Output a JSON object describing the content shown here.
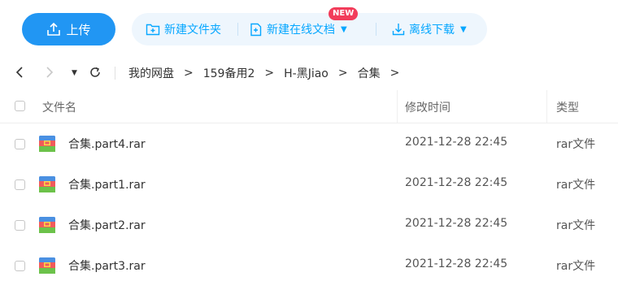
{
  "toolbar": {
    "upload_label": "上传",
    "new_folder_label": "新建文件夹",
    "new_online_doc_label": "新建在线文档",
    "new_badge": "NEW",
    "offline_download_label": "离线下载",
    "accent_color": "#2196f3"
  },
  "breadcrumb": {
    "items": [
      "我的网盘",
      "159备用2",
      "H-黑Jiao",
      "合集"
    ],
    "separator": ">"
  },
  "table": {
    "columns": [
      "文件名",
      "修改时间",
      "类型"
    ],
    "rows": [
      {
        "name": "合集.part4.rar",
        "modified": "2021-12-28 22:45",
        "type": "rar文件"
      },
      {
        "name": "合集.part1.rar",
        "modified": "2021-12-28 22:45",
        "type": "rar文件"
      },
      {
        "name": "合集.part2.rar",
        "modified": "2021-12-28 22:45",
        "type": "rar文件"
      },
      {
        "name": "合集.part3.rar",
        "modified": "2021-12-28 22:45",
        "type": "rar文件"
      }
    ],
    "file_icon": "rar-archive-icon"
  }
}
